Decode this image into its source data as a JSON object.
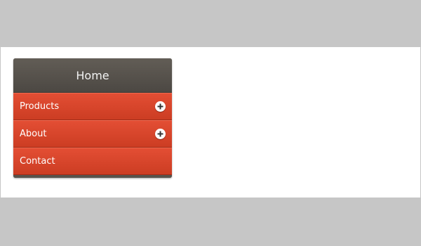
{
  "menu": {
    "home_label": "Home",
    "items": [
      {
        "label": "Products",
        "icon": "plus-circle-icon"
      },
      {
        "label": "About",
        "icon": "plus-circle-icon"
      },
      {
        "label": "Contact"
      }
    ]
  },
  "colors": {
    "background": "#c6c6c6",
    "panel": "#ffffff",
    "header": "#555049",
    "item": "#d8462b"
  }
}
